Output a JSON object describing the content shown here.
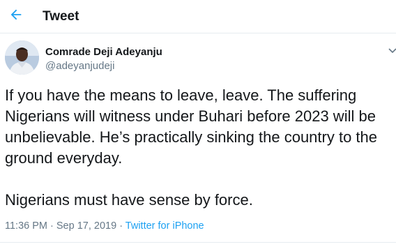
{
  "header": {
    "back_icon": "arrow-left-icon",
    "title": "Tweet",
    "accent_color": "#1da1f2"
  },
  "author": {
    "name": "Comrade Deji Adeyanju",
    "handle": "@adeyanjudeji",
    "avatar_icon": "user-avatar",
    "menu_icon": "chevron-down-icon"
  },
  "tweet": {
    "text": "If you have the means to leave, leave. The suffering Nigerians will witness under Buhari before 2023 will be unbelievable. He’s practically sinking the country to the ground everyday.\n\nNigerians must have sense by force."
  },
  "meta": {
    "time": "11:36 PM",
    "date": "Sep 17, 2019",
    "separator": " · ",
    "source": "Twitter for iPhone"
  }
}
